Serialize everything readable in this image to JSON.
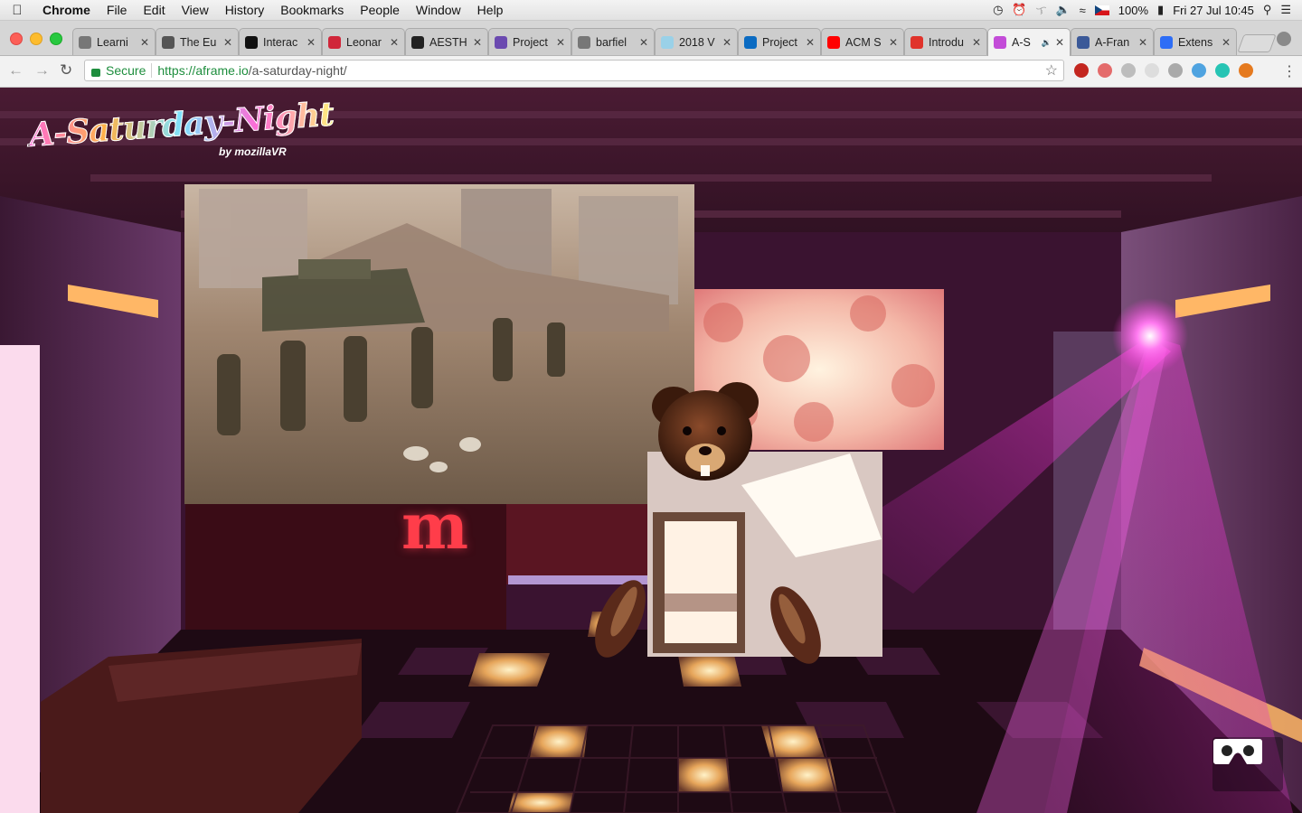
{
  "menubar": {
    "apple_icon": "apple-icon",
    "app_name": "Chrome",
    "menus": [
      "File",
      "Edit",
      "View",
      "History",
      "Bookmarks",
      "People",
      "Window",
      "Help"
    ],
    "battery": "100%",
    "clock": "Fri 27 Jul  10:45"
  },
  "tabs": [
    {
      "label": "Learni",
      "icon": "document-icon",
      "color": "#777777"
    },
    {
      "label": "The Eu",
      "icon": "folder-icon",
      "color": "#555555"
    },
    {
      "label": "Interac",
      "icon": "square-logo-icon",
      "color": "#111111"
    },
    {
      "label": "Leonar",
      "icon": "leonardo-logo-icon",
      "color": "#d0263a"
    },
    {
      "label": "AESTH",
      "icon": "aesthetica-logo-icon",
      "color": "#222222"
    },
    {
      "label": "Project",
      "icon": "purple-logo-icon",
      "color": "#6b4ab0"
    },
    {
      "label": "barfiel",
      "icon": "document-icon",
      "color": "#777777"
    },
    {
      "label": "2018 V",
      "icon": "globe-icon",
      "color": "#9ad1e8"
    },
    {
      "label": "Project",
      "icon": "intel-logo-icon",
      "color": "#0b6bc2"
    },
    {
      "label": "ACM S",
      "icon": "youtube-icon",
      "color": "#ff0000"
    },
    {
      "label": "Introdu",
      "icon": "adobe-logo-icon",
      "color": "#e0332b"
    },
    {
      "label": "A-S",
      "icon": "aframe-logo-icon",
      "color": "#c34cd8",
      "active": true,
      "audio": "speaker-icon"
    },
    {
      "label": "A-Fran",
      "icon": "facebook-icon",
      "color": "#3b5998"
    },
    {
      "label": "Extens",
      "icon": "puzzle-icon",
      "color": "#2d6df6"
    }
  ],
  "toolbar": {
    "secure_label": "Secure",
    "url_host": "https://aframe.io",
    "url_path": "/a-saturday-night/",
    "extensions": [
      {
        "name": "ublock-icon",
        "color": "#c3261f"
      },
      {
        "name": "blocked-icon",
        "color": "#e46b6b"
      },
      {
        "name": "b-icon",
        "color": "#bdbdbd"
      },
      {
        "name": "f-icon",
        "color": "#dddddd"
      },
      {
        "name": "stop-gif-icon",
        "color": "#aaaaaa"
      },
      {
        "name": "download-icon",
        "color": "#4fa3e0"
      },
      {
        "name": "m-icon",
        "color": "#27c4b4"
      },
      {
        "name": "h-icon",
        "color": "#e57a1f"
      }
    ]
  },
  "scene": {
    "logo_title": "A-Saturday-Night",
    "logo_by": "by mozillaVR",
    "brand_mark": "m",
    "vr_button_icon": "cardboard-vr-icon"
  }
}
